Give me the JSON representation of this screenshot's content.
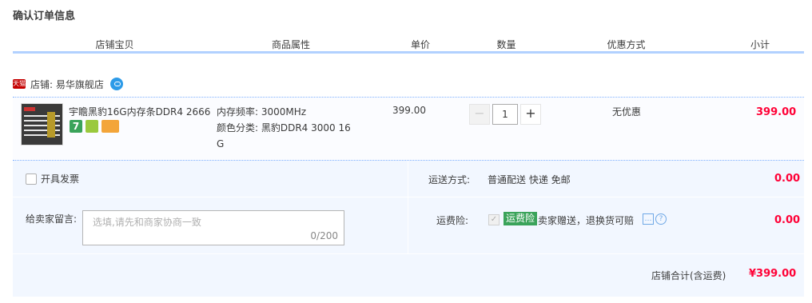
{
  "page_title": "确认订单信息",
  "columns": [
    "店铺宝贝",
    "商品属性",
    "单价",
    "数量",
    "优惠方式",
    "小计"
  ],
  "shop": {
    "tmall_badge": "天猫",
    "label": "店铺: 易华旗舰店"
  },
  "item": {
    "name": "宇瞻黑豹16G内存条DDR4 2666",
    "attributes": [
      "内存频率: 3000MHz",
      "颜色分类: 黑豹DDR4 3000 16",
      "G"
    ],
    "price": "399.00",
    "quantity": "1",
    "qty_minus": "−",
    "qty_plus": "+",
    "discount": "无优惠",
    "subtotal": "399.00",
    "service_icons": [
      "seven-day-return-icon",
      "guarantee-icon",
      "card-icon"
    ]
  },
  "invoice": {
    "label": "开具发票"
  },
  "message": {
    "label": "给卖家留言:",
    "placeholder": "选填,请先和商家协商一致",
    "counter": "0/200"
  },
  "shipping": {
    "label": "运送方式:",
    "method": "普通配送 快递 免邮",
    "fee": "0.00"
  },
  "insurance": {
    "label": "运费险:",
    "tag": "运费险",
    "desc": "卖家赠送，退换货可赔",
    "fee": "0.00"
  },
  "total": {
    "label": "店铺合计(含运费)",
    "value": "¥399.00"
  },
  "colors": {
    "accent_red": "#ff0036",
    "header_line": "#b2d1ff",
    "panel_bg": "#f2f7ff",
    "insurance_green": "#3aa35a"
  }
}
